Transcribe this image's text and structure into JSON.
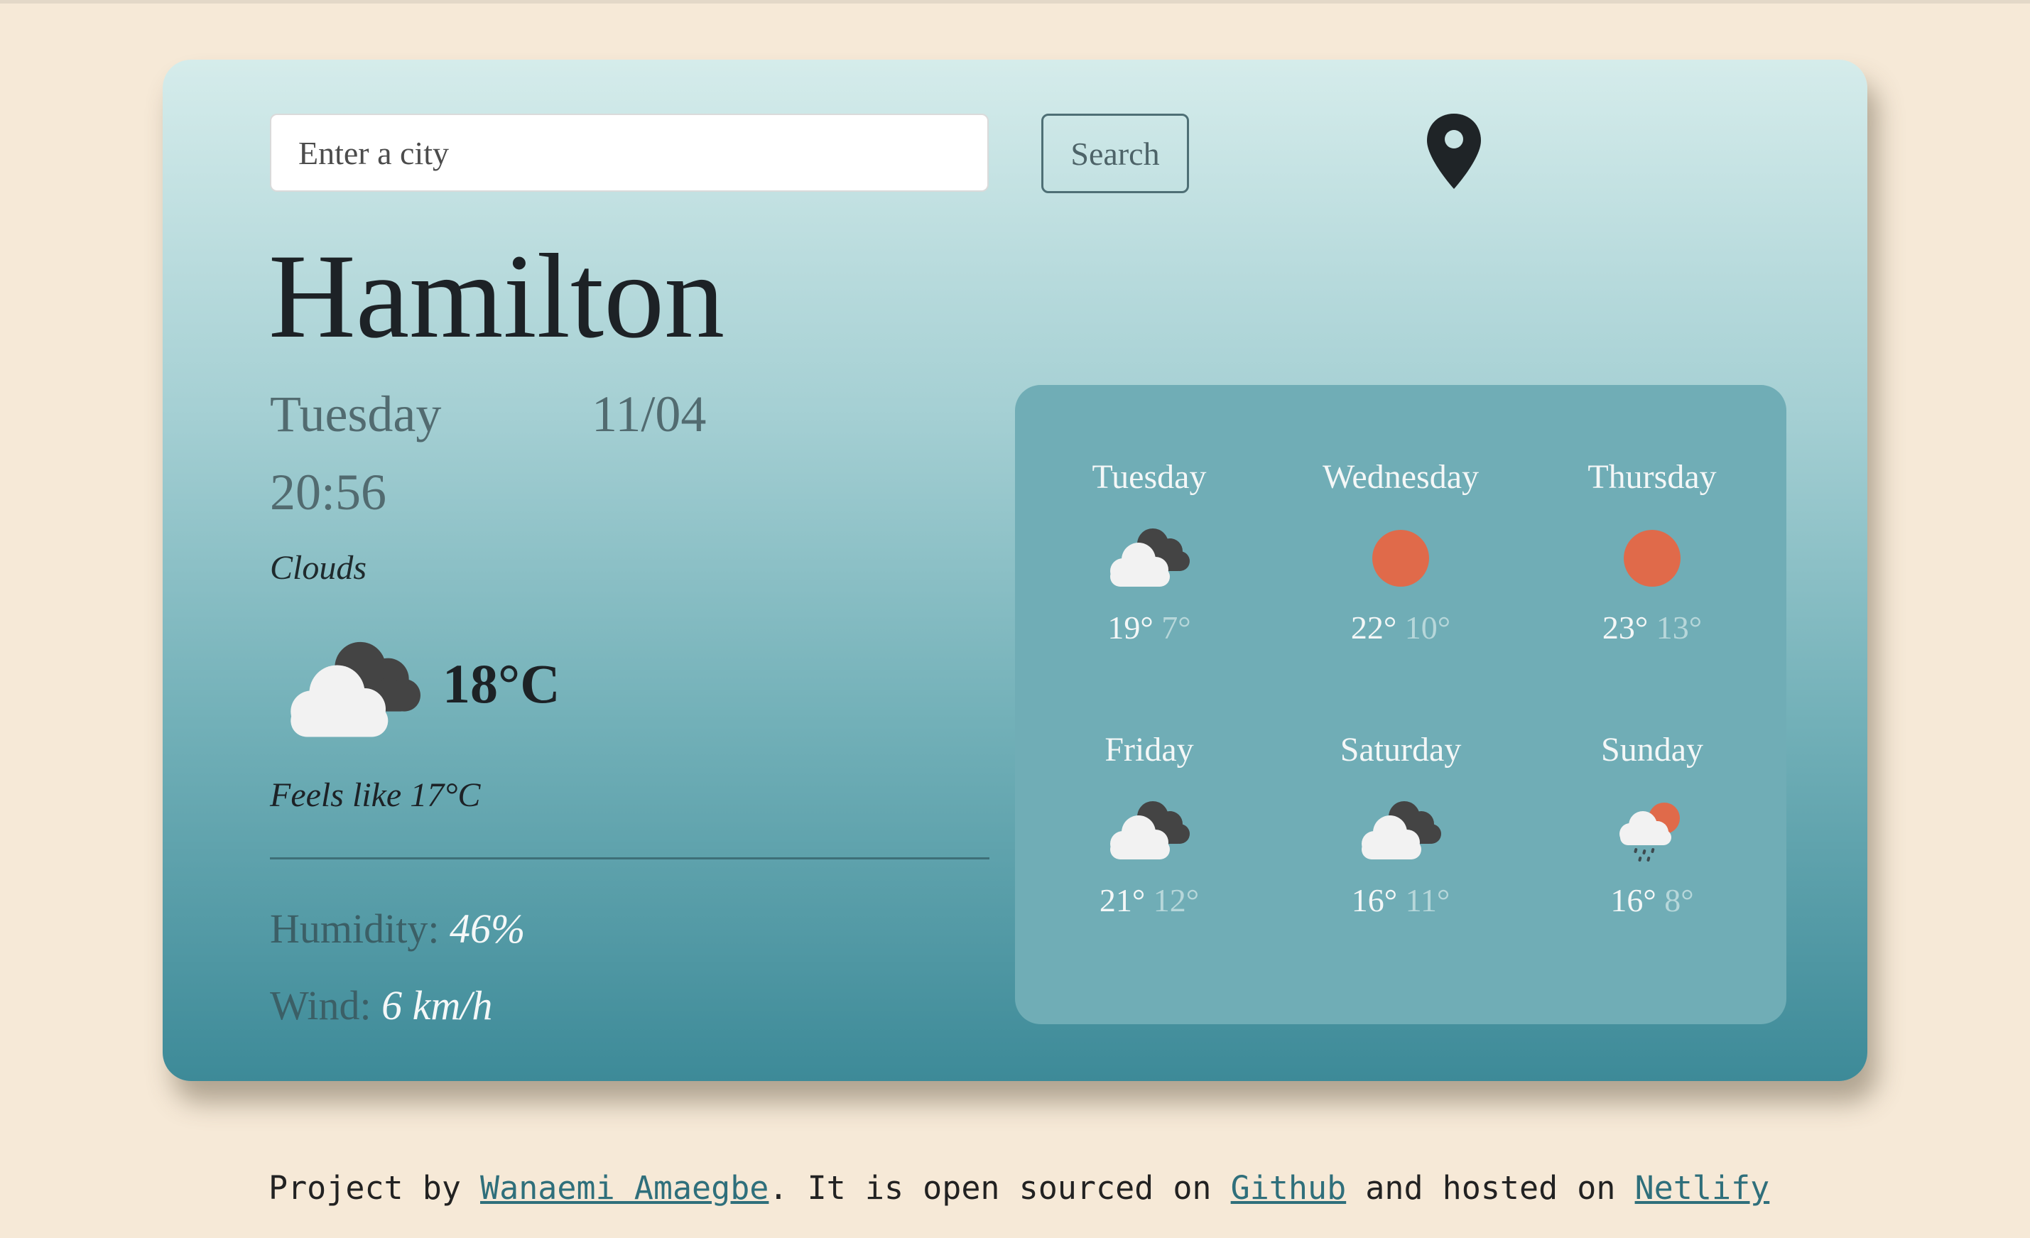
{
  "search": {
    "placeholder": "Enter a city",
    "button_label": "Search"
  },
  "current": {
    "city": "Hamilton",
    "day": "Tuesday",
    "date": "11/04",
    "time": "20:56",
    "description": "Clouds",
    "icon": "broken-clouds-icon",
    "temperature": "18°C",
    "feels_like": "Feels like 17°C",
    "humidity_label": "Humidity:",
    "humidity_value": "46%",
    "wind_label": "Wind:",
    "wind_value": "6 km/h"
  },
  "forecast": [
    {
      "day": "Tuesday",
      "icon": "broken-clouds-icon",
      "max": "19°",
      "min": "7°"
    },
    {
      "day": "Wednesday",
      "icon": "clear-sun-icon",
      "max": "22°",
      "min": "10°"
    },
    {
      "day": "Thursday",
      "icon": "clear-sun-icon",
      "max": "23°",
      "min": "13°"
    },
    {
      "day": "Friday",
      "icon": "broken-clouds-icon",
      "max": "21°",
      "min": "12°"
    },
    {
      "day": "Saturday",
      "icon": "broken-clouds-icon",
      "max": "16°",
      "min": "11°"
    },
    {
      "day": "Sunday",
      "icon": "sun-rain-icon",
      "max": "16°",
      "min": "8°"
    }
  ],
  "footer": {
    "prefix": "Project by ",
    "author": "Wanaemi Amaegbe",
    "middle": ". It is open sourced on ",
    "github": "Github",
    "and_hosted": " and hosted on ",
    "netlify": "Netlify"
  },
  "colors": {
    "background": "#f6e9d7",
    "card_top": "#d5eceb",
    "card_bottom": "#3d8a98",
    "forecast_panel": "#70adb6",
    "sun": "#e06a4a",
    "dark_cloud": "#444444",
    "light_cloud": "#f2f2f2"
  }
}
